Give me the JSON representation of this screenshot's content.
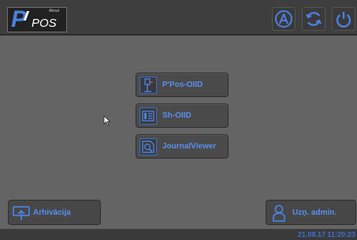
{
  "logo": {
    "letter": "P",
    "pos": "POS",
    "about": "About"
  },
  "header": {
    "icons": [
      "logo-icon",
      "auto-icon",
      "refresh-icon",
      "power-icon"
    ]
  },
  "menu": [
    {
      "label": "P'Pos-OIID",
      "icon": "tool-icon"
    },
    {
      "label": "Sh-OIID",
      "icon": "list-icon"
    },
    {
      "label": "JournalViewer",
      "icon": "journal-icon"
    }
  ],
  "bottom": {
    "archive_label": "Arhivācija",
    "admin_label": "Uzņ. admin."
  },
  "status": {
    "datetime": "21.08.17    11:20:23"
  },
  "colors": {
    "accent": "#4c7fe0",
    "background": "#646464",
    "topbar": "#3e3e3e"
  }
}
